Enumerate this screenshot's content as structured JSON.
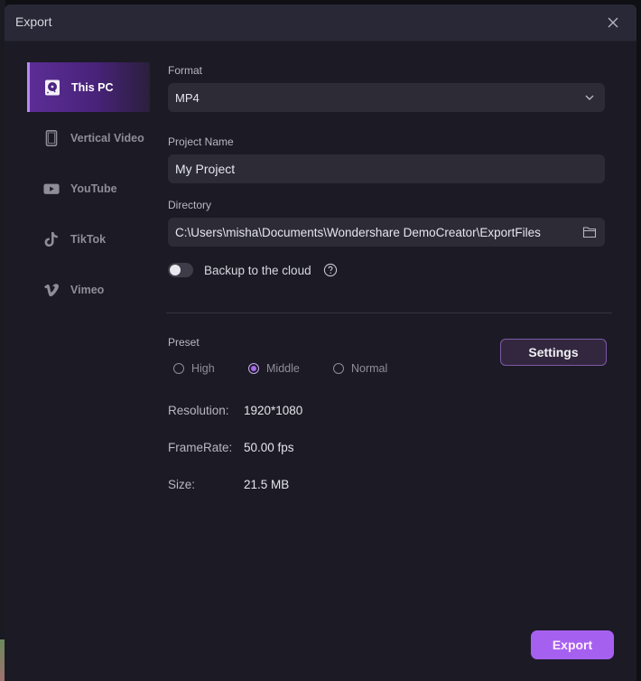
{
  "dialog": {
    "title": "Export"
  },
  "sidebar": {
    "items": [
      {
        "label": "This PC",
        "icon": "hard-drive-icon",
        "active": true
      },
      {
        "label": "Vertical Video",
        "icon": "phone-portrait-icon",
        "active": false
      },
      {
        "label": "YouTube",
        "icon": "youtube-icon",
        "active": false
      },
      {
        "label": "TikTok",
        "icon": "tiktok-icon",
        "active": false
      },
      {
        "label": "Vimeo",
        "icon": "vimeo-icon",
        "active": false
      }
    ]
  },
  "form": {
    "format": {
      "label": "Format",
      "value": "MP4"
    },
    "project_name": {
      "label": "Project Name",
      "value": "My Project"
    },
    "directory": {
      "label": "Directory",
      "value": "C:\\Users\\misha\\Documents\\Wondershare DemoCreator\\ExportFiles"
    },
    "backup": {
      "label": "Backup to the cloud",
      "enabled": false
    }
  },
  "preset": {
    "label": "Preset",
    "options": [
      {
        "label": "High",
        "checked": false
      },
      {
        "label": "Middle",
        "checked": true
      },
      {
        "label": "Normal",
        "checked": false
      }
    ],
    "settings_label": "Settings"
  },
  "info": {
    "resolution": {
      "key": "Resolution:",
      "value": "1920*1080"
    },
    "framerate": {
      "key": "FrameRate:",
      "value": "50.00 fps"
    },
    "size": {
      "key": "Size:",
      "value": "21.5 MB"
    }
  },
  "footer": {
    "export_label": "Export"
  },
  "colors": {
    "accent": "#a660f0",
    "active_nav": "#5c2d96",
    "background": "#1c1b25",
    "titlebar": "#292836"
  }
}
